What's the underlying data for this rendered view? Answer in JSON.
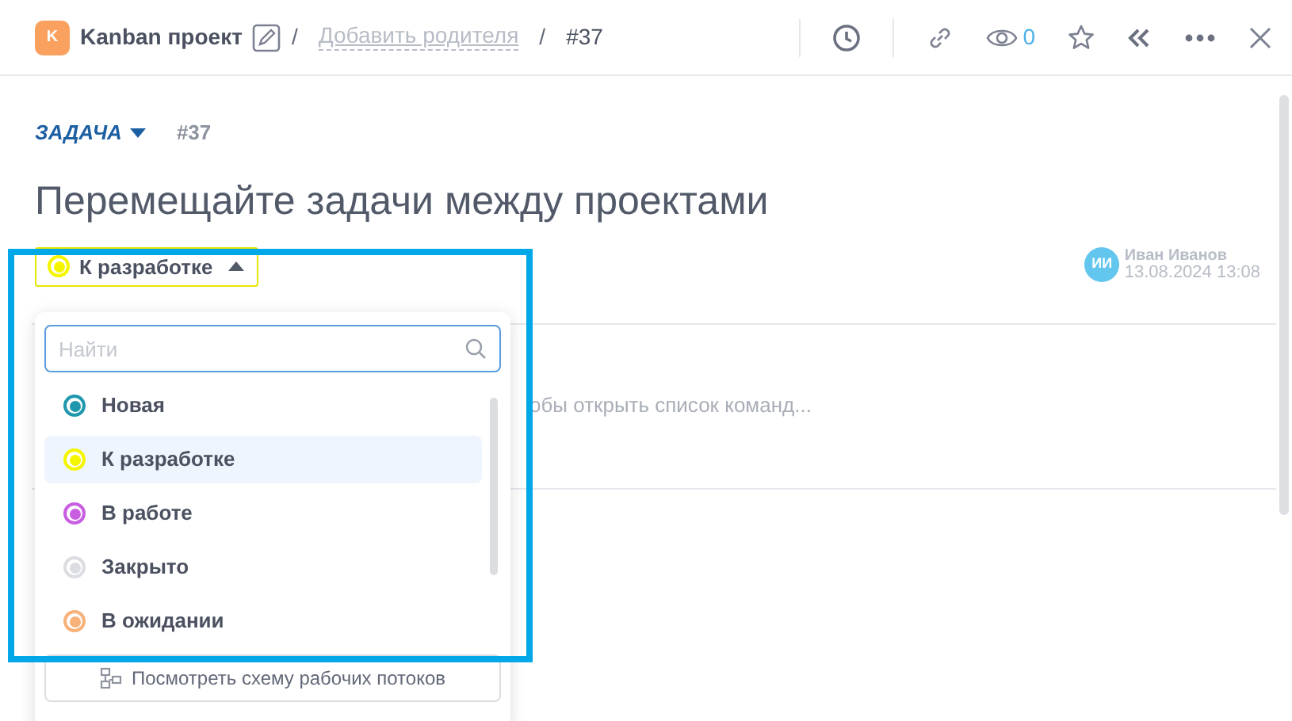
{
  "breadcrumb": {
    "project_badge": "K",
    "project": "Kanban проект",
    "separator_1": "/",
    "add_parent": "Добавить родителя",
    "separator_2": "/",
    "task_number": "#37"
  },
  "toolbar": {
    "watchers": "0"
  },
  "task": {
    "type": "ЗАДАЧА",
    "number": "#37",
    "title": "Перемещайте задачи между проектами",
    "status": {
      "label": "К разработке",
      "color": "#f5f500"
    }
  },
  "author": {
    "initials": "ИИ",
    "name": "Иван Иванов",
    "date": "13.08.2024 13:08"
  },
  "editor": {
    "hint": "обы открыть список команд..."
  },
  "status_dropdown": {
    "search": {
      "placeholder": "Найти"
    },
    "items": [
      {
        "label": "Новая",
        "color": "#1f98ad",
        "selected": false
      },
      {
        "label": "К разработке",
        "color": "#f5f500",
        "selected": true
      },
      {
        "label": "В работе",
        "color": "#c85ee0",
        "selected": false
      },
      {
        "label": "Закрыто",
        "color": "#dcdde2",
        "selected": false
      },
      {
        "label": "В ожидании",
        "color": "#f7b27a",
        "selected": false
      }
    ],
    "workflow_button": "Посмотреть схему рабочих потоков"
  }
}
